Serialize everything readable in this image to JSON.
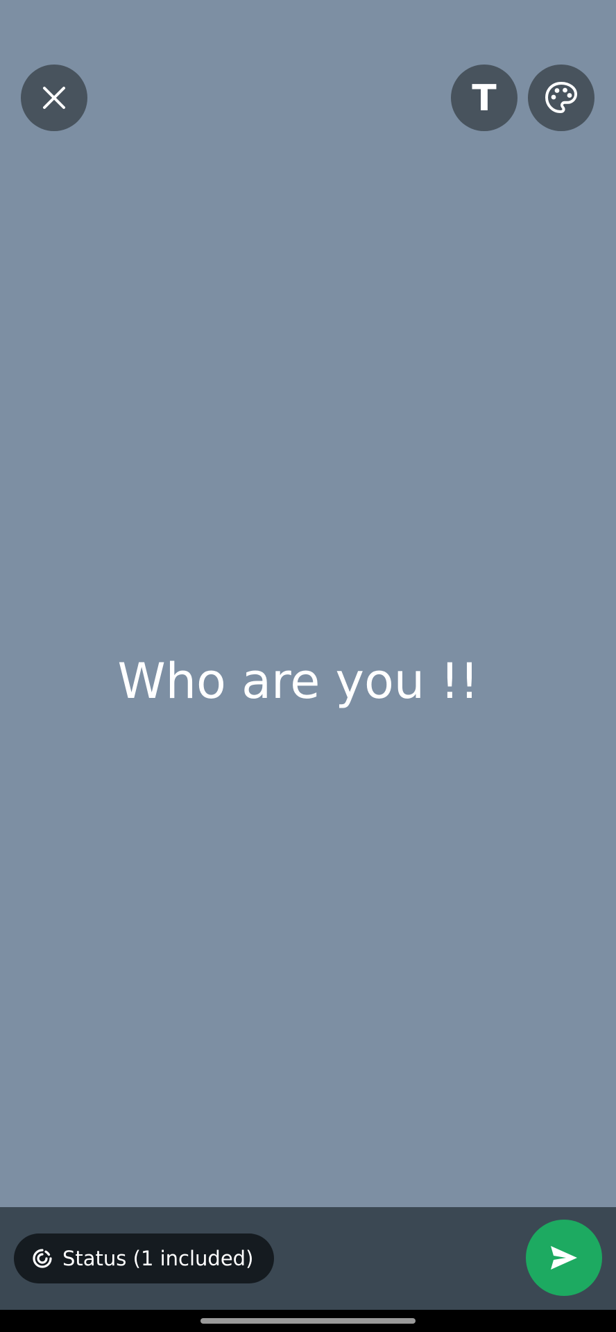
{
  "colors": {
    "background": "#7d8fa3",
    "top_button_bg": "#48535d",
    "bottom_bar_bg": "#3b4853",
    "pill_bg": "#151b20",
    "send_bg": "#1daa61"
  },
  "top_bar": {
    "close_icon": "close-icon",
    "text_button_label": "T",
    "palette_icon": "palette-icon"
  },
  "canvas": {
    "text": "Who are you !!"
  },
  "bottom_bar": {
    "audience_label": "Status (1 included)",
    "status_icon": "status-ring-icon",
    "send_icon": "send-icon"
  }
}
